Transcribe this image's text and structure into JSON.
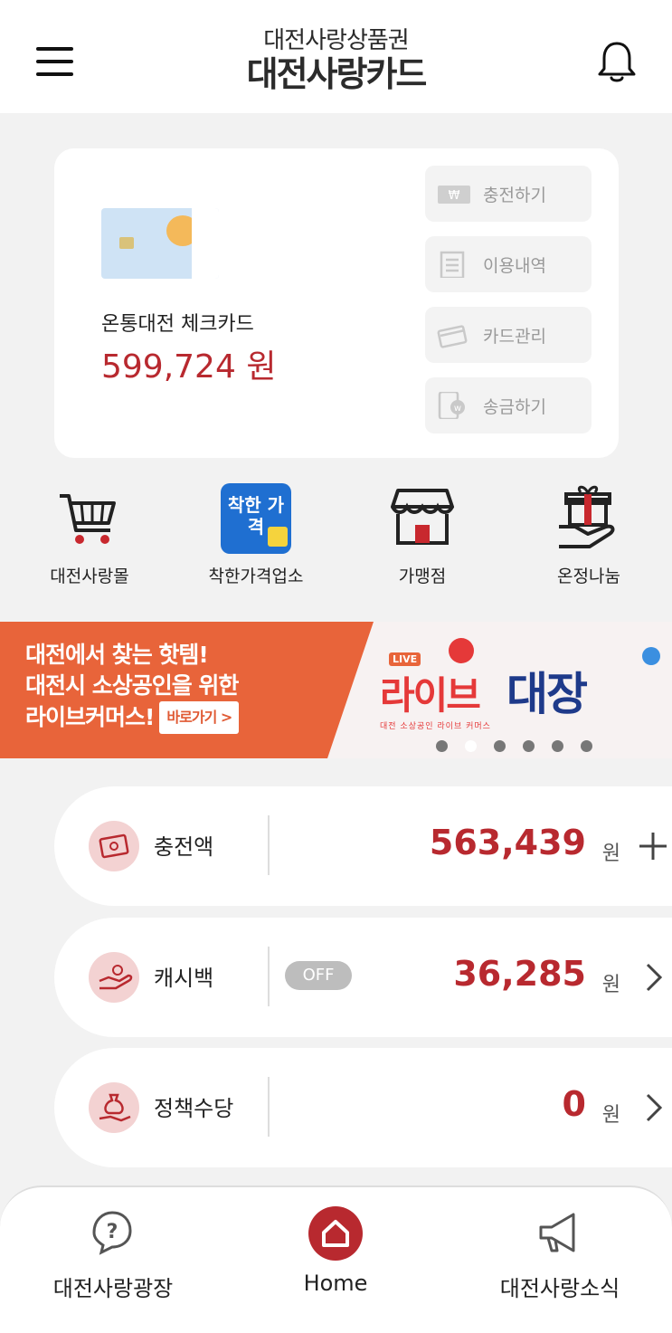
{
  "header": {
    "logo_sub": "대전사랑상품권",
    "logo_main": "대전사랑카드"
  },
  "card": {
    "name": "온통대전 체크카드",
    "balance": "599,724 원"
  },
  "actions": [
    {
      "label": "충전하기",
      "icon": "won-bill-icon"
    },
    {
      "label": "이용내역",
      "icon": "receipt-icon"
    },
    {
      "label": "카드관리",
      "icon": "card-icon"
    },
    {
      "label": "송금하기",
      "icon": "phone-transfer-icon"
    }
  ],
  "quick_menu": [
    {
      "label": "대전사랑몰",
      "icon": "cart-icon"
    },
    {
      "label": "착한가격업소",
      "icon": "good-price-icon",
      "icon_text": "착한 가격"
    },
    {
      "label": "가맹점",
      "icon": "store-icon"
    },
    {
      "label": "온정나눔",
      "icon": "gift-hand-icon"
    }
  ],
  "banner": {
    "line1": "대전에서 찾는 핫템!",
    "line2": "대전시 소상공인을 위한",
    "line3": "라이브커머스!",
    "cta": "바로가기 >",
    "brand_live": "LIVE",
    "brand_title_a": "라이브",
    "brand_title_b": "대장",
    "brand_sub": "대전 소상공인 라이브 커머스",
    "slide_count": 6,
    "active_slide": 2
  },
  "rows": [
    {
      "label": "충전액",
      "value": "563,439",
      "unit": "원",
      "action": "plus-icon"
    },
    {
      "label": "캐시백",
      "toggle": "OFF",
      "value": "36,285",
      "unit": "원",
      "action": "chevron-right-icon"
    },
    {
      "label": "정책수당",
      "value": "0",
      "unit": "원",
      "action": "chevron-right-icon"
    }
  ],
  "tabs": [
    {
      "label": "대전사랑광장",
      "icon": "question-chat-icon"
    },
    {
      "label": "Home",
      "icon": "home-icon"
    },
    {
      "label": "대전사랑소식",
      "icon": "megaphone-icon"
    }
  ],
  "colors": {
    "accent": "#b8292f",
    "banner_orange": "#e8643a",
    "badge_pink": "#f3d2d2"
  }
}
